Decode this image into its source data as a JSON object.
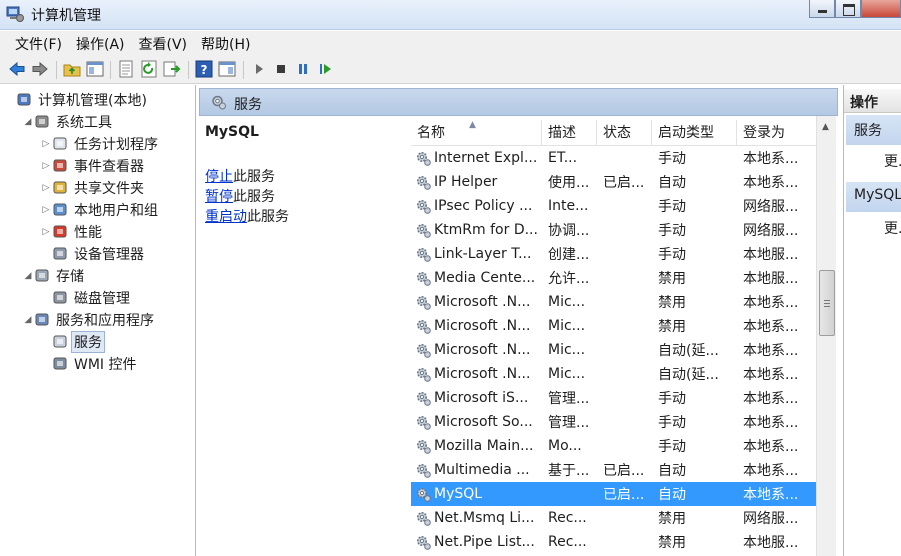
{
  "window": {
    "title": "计算机管理"
  },
  "menu": [
    "文件(F)",
    "操作(A)",
    "查看(V)",
    "帮助(H)"
  ],
  "tree": [
    {
      "label": "计算机管理(本地)",
      "level": 0,
      "arrow": "",
      "icon": "computer-management-icon"
    },
    {
      "label": "系统工具",
      "level": 1,
      "arrow": "◢",
      "icon": "system-tools-icon"
    },
    {
      "label": "任务计划程序",
      "level": 2,
      "arrow": "▷",
      "icon": "task-scheduler-icon"
    },
    {
      "label": "事件查看器",
      "level": 2,
      "arrow": "▷",
      "icon": "event-viewer-icon"
    },
    {
      "label": "共享文件夹",
      "level": 2,
      "arrow": "▷",
      "icon": "shared-folders-icon"
    },
    {
      "label": "本地用户和组",
      "level": 2,
      "arrow": "▷",
      "icon": "local-users-icon"
    },
    {
      "label": "性能",
      "level": 2,
      "arrow": "▷",
      "icon": "performance-icon"
    },
    {
      "label": "设备管理器",
      "level": 2,
      "arrow": "",
      "icon": "device-manager-icon"
    },
    {
      "label": "存储",
      "level": 1,
      "arrow": "◢",
      "icon": "storage-icon"
    },
    {
      "label": "磁盘管理",
      "level": 2,
      "arrow": "",
      "icon": "disk-management-icon"
    },
    {
      "label": "服务和应用程序",
      "level": 1,
      "arrow": "◢",
      "icon": "services-apps-icon"
    },
    {
      "label": "服务",
      "level": 2,
      "arrow": "",
      "icon": "services-gear-icon",
      "selected": true
    },
    {
      "label": "WMI 控件",
      "level": 2,
      "arrow": "",
      "icon": "wmi-control-icon"
    }
  ],
  "center": {
    "header": "服务"
  },
  "detail": {
    "title": "MySQL",
    "links": [
      {
        "link": "停止",
        "rest": "此服务"
      },
      {
        "link": "暂停",
        "rest": "此服务"
      },
      {
        "link": "重启动",
        "rest": "此服务"
      }
    ]
  },
  "columns": [
    "名称",
    "描述",
    "状态",
    "启动类型",
    "登录为"
  ],
  "services": [
    {
      "name": "Internet Expl...",
      "desc": "ET...",
      "status": "",
      "startup": "手动",
      "logon": "本地系..."
    },
    {
      "name": "IP Helper",
      "desc": "使用...",
      "status": "已启...",
      "startup": "自动",
      "logon": "本地系..."
    },
    {
      "name": "IPsec Policy ...",
      "desc": "Inte...",
      "status": "",
      "startup": "手动",
      "logon": "网络服..."
    },
    {
      "name": "KtmRm for D...",
      "desc": "协调...",
      "status": "",
      "startup": "手动",
      "logon": "网络服..."
    },
    {
      "name": "Link-Layer T...",
      "desc": "创建...",
      "status": "",
      "startup": "手动",
      "logon": "本地服..."
    },
    {
      "name": "Media Cente...",
      "desc": "允许...",
      "status": "",
      "startup": "禁用",
      "logon": "本地服..."
    },
    {
      "name": "Microsoft .N...",
      "desc": "Mic...",
      "status": "",
      "startup": "禁用",
      "logon": "本地系..."
    },
    {
      "name": "Microsoft .N...",
      "desc": "Mic...",
      "status": "",
      "startup": "禁用",
      "logon": "本地系..."
    },
    {
      "name": "Microsoft .N...",
      "desc": "Mic...",
      "status": "",
      "startup": "自动(延...",
      "logon": "本地系..."
    },
    {
      "name": "Microsoft .N...",
      "desc": "Mic...",
      "status": "",
      "startup": "自动(延...",
      "logon": "本地系..."
    },
    {
      "name": "Microsoft iS...",
      "desc": "管理...",
      "status": "",
      "startup": "手动",
      "logon": "本地系..."
    },
    {
      "name": "Microsoft So...",
      "desc": "管理...",
      "status": "",
      "startup": "手动",
      "logon": "本地系..."
    },
    {
      "name": "Mozilla Main...",
      "desc": "Mo...",
      "status": "",
      "startup": "手动",
      "logon": "本地系..."
    },
    {
      "name": "Multimedia ...",
      "desc": "基于...",
      "status": "已启...",
      "startup": "自动",
      "logon": "本地系..."
    },
    {
      "name": "MySQL",
      "desc": "",
      "status": "已启...",
      "startup": "自动",
      "logon": "本地系...",
      "selected": true
    },
    {
      "name": "Net.Msmq Li...",
      "desc": "Rec...",
      "status": "",
      "startup": "禁用",
      "logon": "网络服..."
    },
    {
      "name": "Net.Pipe List...",
      "desc": "Rec...",
      "status": "",
      "startup": "禁用",
      "logon": "本地服..."
    }
  ],
  "actions": {
    "header": "操作",
    "sections": [
      {
        "title": "服务",
        "item": "更..."
      },
      {
        "title": "MySQL",
        "item": "更..."
      }
    ]
  },
  "colors": {
    "selection": "#3399ff",
    "link": "#0033cc",
    "header_blue": "#b3c8e3"
  }
}
